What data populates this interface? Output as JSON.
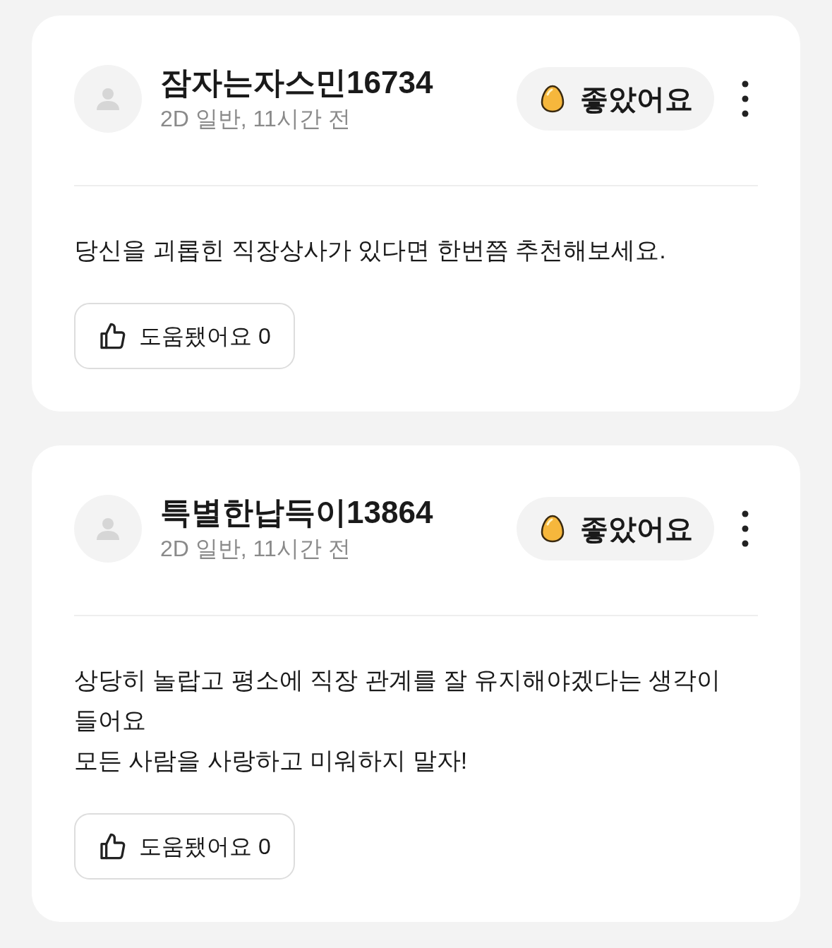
{
  "reviews": [
    {
      "author": "잠자는자스민16734",
      "meta": "2D 일반, 11시간 전",
      "reaction": "좋았어요",
      "body": [
        "당신을 괴롭힌 직장상사가 있다면 한번쯤 추천해보세요."
      ],
      "helpful": "도움됐어요 0"
    },
    {
      "author": "특별한납득이13864",
      "meta": "2D 일반, 11시간 전",
      "reaction": "좋았어요",
      "body": [
        "상당히 놀랍고 평소에 직장 관계를 잘 유지해야겠다는 생각이 들어요",
        "모든 사람을 사랑하고 미워하지 말자!"
      ],
      "helpful": "도움됐어요 0"
    }
  ]
}
